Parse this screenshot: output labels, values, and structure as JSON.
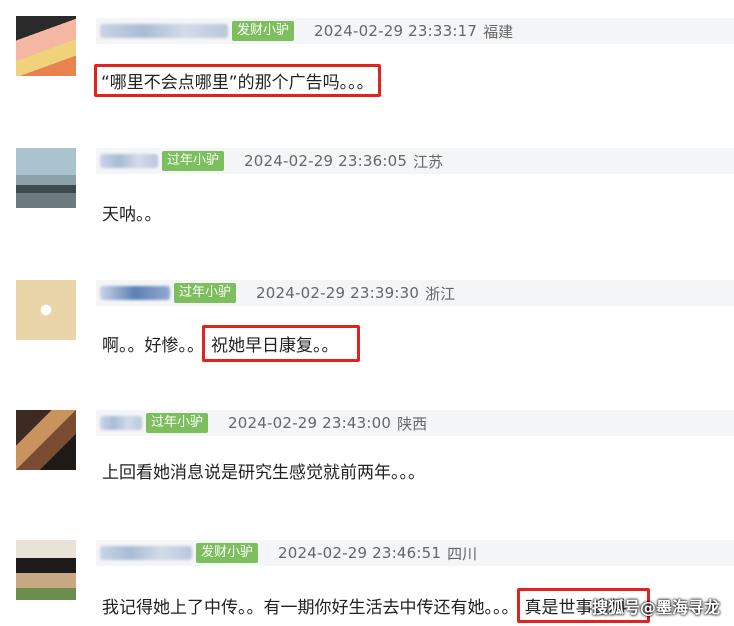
{
  "comments": [
    {
      "badge": "发财小驴",
      "time": "2024-02-29 23:33:17",
      "region": "福建",
      "pre": "",
      "highlight": "“哪里不会点哪里”的那个广告吗。。。"
    },
    {
      "badge": "过年小驴",
      "time": "2024-02-29 23:36:05",
      "region": "江苏",
      "pre": "天呐。。",
      "highlight": ""
    },
    {
      "badge": "过年小驴",
      "time": "2024-02-29 23:39:30",
      "region": "浙江",
      "pre": "啊。。好惨。。",
      "highlight": "祝她早日康复。。"
    },
    {
      "badge": "过年小驴",
      "time": "2024-02-29 23:43:00",
      "region": "陕西",
      "pre": "上回看她消息说是研究生感觉就前两年。。。",
      "highlight": ""
    },
    {
      "badge": "发财小驴",
      "time": "2024-02-29 23:46:51",
      "region": "四川",
      "pre": "我记得她上了中传。。有一期你好生活去中传还有她。。。",
      "highlight": "真是世事造料"
    }
  ],
  "watermark": "搜狐号@墨海寻龙",
  "colors": {
    "badge": "#7dbf5e",
    "highlight_border": "#e0231c",
    "meta_bg": "#f4f5f7"
  }
}
